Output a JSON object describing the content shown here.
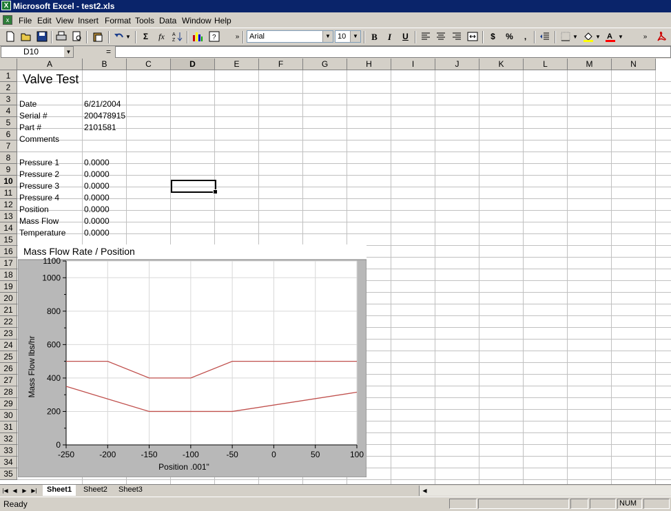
{
  "window": {
    "title": "Microsoft Excel - test2.xls"
  },
  "menu": [
    "File",
    "Edit",
    "View",
    "Insert",
    "Format",
    "Tools",
    "Data",
    "Window",
    "Help"
  ],
  "toolbar": {
    "font": "Arial",
    "size": "10",
    "bold": "B",
    "italic": "I",
    "underline": "U",
    "currency": "$",
    "percent": "%",
    "comma": ",",
    "sum": "Σ",
    "fx": "fx"
  },
  "formula_bar": {
    "name_box": "D10",
    "equals": "=",
    "value": ""
  },
  "columns": [
    "A",
    "B",
    "C",
    "D",
    "E",
    "F",
    "G",
    "H",
    "I",
    "J",
    "K",
    "L",
    "M",
    "N"
  ],
  "selected_column": "D",
  "selected_row": 10,
  "rows": [
    1,
    2,
    3,
    4,
    5,
    6,
    7,
    8,
    9,
    10,
    11,
    12,
    13,
    14,
    15,
    16,
    17,
    18,
    19,
    20,
    21,
    22,
    23,
    24,
    25,
    26,
    27,
    28,
    29,
    30,
    31,
    32,
    33,
    34,
    35
  ],
  "cells": {
    "a1": "Valve Test",
    "a3": "Date",
    "b3": "6/21/2004",
    "a4": "Serial #",
    "b4": "200478915",
    "a5": "Part #",
    "b5": "2101581",
    "a6": "Comments",
    "a8": "Pressure 1",
    "b8": "0.0000",
    "a9": "Pressure 2",
    "b9": "0.0000",
    "a10": "Pressure 3",
    "b10": "0.0000",
    "a11": "Pressure 4",
    "b11": "0.0000",
    "a12": "Position",
    "b12": "0.0000",
    "a13": "Mass Flow",
    "b13": "0.0000",
    "a14": "Temperature",
    "b14": "0.0000"
  },
  "chart_data": {
    "type": "line",
    "title": "Mass Flow Rate / Position",
    "xlabel": "Position .001\"",
    "ylabel": "Mass Flow lbs/hr",
    "xlim": [
      -250,
      100
    ],
    "ylim": [
      0,
      1100
    ],
    "x_ticks": [
      "-250",
      "-200",
      "-150",
      "-100",
      "-50",
      "0",
      "50",
      "100"
    ],
    "y_ticks": [
      "0",
      "200",
      "400",
      "600",
      "800",
      "1000",
      "1100"
    ],
    "grid": true,
    "color": "#c0504d",
    "series": [
      {
        "x": [
          -250,
          -200,
          -150,
          -100,
          -50,
          100
        ],
        "y": [
          500,
          500,
          400,
          400,
          500,
          500
        ]
      },
      {
        "x": [
          -250,
          -150,
          -50,
          100
        ],
        "y": [
          350,
          200,
          200,
          315
        ]
      }
    ]
  },
  "sheet_tabs": [
    "Sheet1",
    "Sheet2",
    "Sheet3"
  ],
  "active_sheet": "Sheet1",
  "status": {
    "left": "Ready",
    "num": "NUM"
  }
}
